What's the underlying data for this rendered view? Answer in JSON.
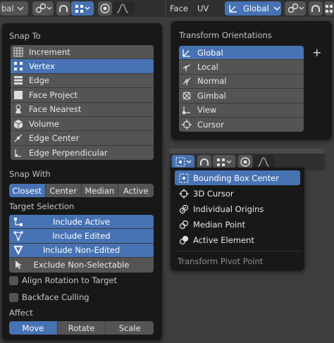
{
  "header_left": {
    "mode_text": "bal"
  },
  "header_right": {
    "face_label": "Face",
    "uv_label": "UV",
    "orientation_value": "Global"
  },
  "snap_panel": {
    "snap_to_title": "Snap To",
    "snap_to_items": [
      {
        "label": "Increment",
        "icon": "increment-icon"
      },
      {
        "label": "Vertex",
        "icon": "vertex-icon"
      },
      {
        "label": "Edge",
        "icon": "edge-icon"
      },
      {
        "label": "Face Project",
        "icon": "face-project-icon"
      },
      {
        "label": "Face Nearest",
        "icon": "face-nearest-icon"
      },
      {
        "label": "Volume",
        "icon": "volume-icon"
      },
      {
        "label": "Edge Center",
        "icon": "edge-center-icon"
      },
      {
        "label": "Edge Perpendicular",
        "icon": "edge-perpendicular-icon"
      }
    ],
    "snap_to_selected": "Vertex",
    "snap_with_title": "Snap With",
    "snap_with_options": [
      "Closest",
      "Center",
      "Median",
      "Active"
    ],
    "snap_with_selected": "Closest",
    "target_title": "Target Selection",
    "target_items": [
      {
        "label": "Include Active",
        "active": true
      },
      {
        "label": "Include Edited",
        "active": true
      },
      {
        "label": "Include Non-Edited",
        "active": true
      },
      {
        "label": "Exclude Non-Selectable",
        "active": false
      }
    ],
    "align_rotation_label": "Align Rotation to Target",
    "backface_label": "Backface Culling",
    "affect_title": "Affect",
    "affect_options": [
      "Move",
      "Rotate",
      "Scale"
    ],
    "affect_selected": "Move"
  },
  "orientation_panel": {
    "title": "Transform Orientations",
    "items": [
      "Global",
      "Local",
      "Normal",
      "Gimbal",
      "View",
      "Cursor"
    ],
    "selected": "Global",
    "add_label": "+"
  },
  "pivot_panel": {
    "items": [
      "Bounding Box Center",
      "3D Cursor",
      "Individual Origins",
      "Median Point",
      "Active Element"
    ],
    "selected": "Bounding Box Center",
    "title": "Transform Pivot Point"
  },
  "colors": {
    "accent": "#4772b3",
    "panel_bg": "#181818",
    "button": "#545454"
  }
}
